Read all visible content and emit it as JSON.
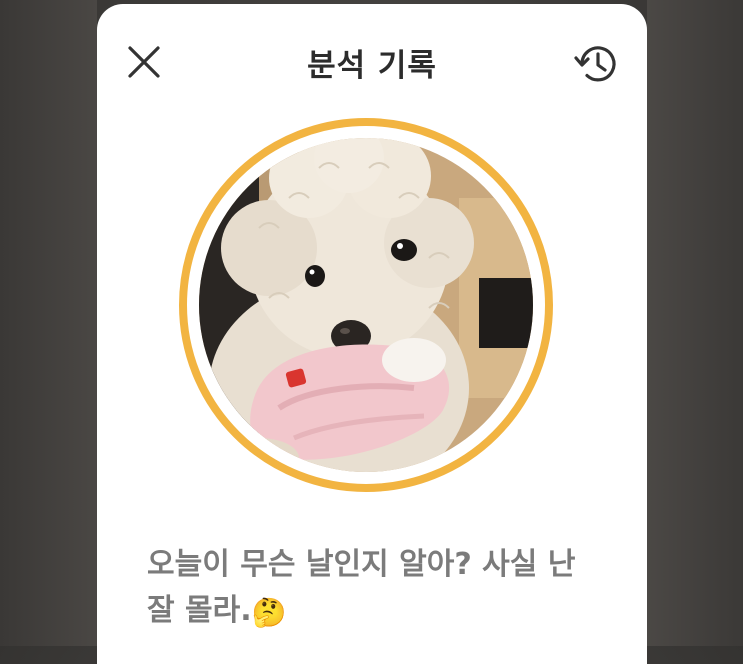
{
  "background": {
    "color": "#3f3d3b"
  },
  "sheet": {
    "title": "분석 기록",
    "close_icon": "close-icon",
    "history_icon": "history-icon"
  },
  "profile": {
    "ring_color": "#f2b441",
    "photo": "poodle-with-pink-toy"
  },
  "message": {
    "text": "오늘이 무슨 날인지 알아? 사실 난 잘 몰라.",
    "emoji": "🤔"
  }
}
